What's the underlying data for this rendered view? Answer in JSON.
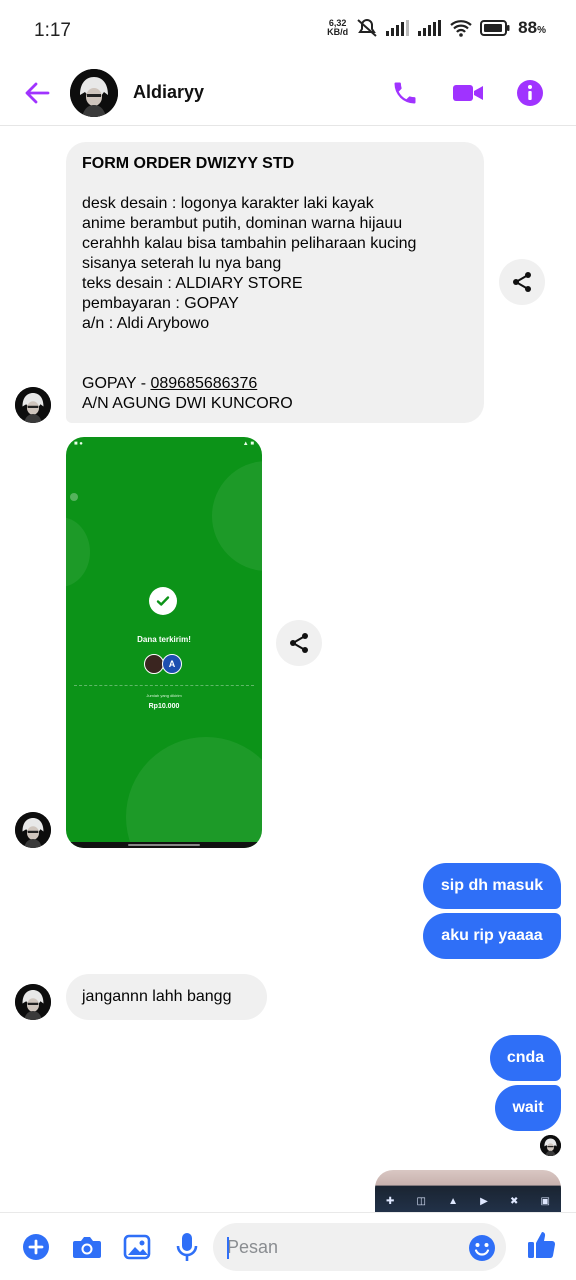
{
  "status_bar": {
    "time": "1:17",
    "net_speed_value": "6,32",
    "net_speed_unit": "KB/d",
    "battery_value": "88",
    "battery_unit": "%"
  },
  "header": {
    "contact_name": "Aldiaryy",
    "back_icon": "arrow-left-icon",
    "actions": [
      "phone-icon",
      "video-icon",
      "info-icon"
    ]
  },
  "messages": {
    "form_order": {
      "lines": [
        "FORM ORDER DWIZYY STD",
        "",
        "desk desain : logonya karakter laki kayak",
        "anime berambut putih, dominan warna hijauu",
        "cerahhh kalau bisa tambahin peliharaan kucing",
        "sisanya seterah lu nya bang",
        "teks desain : ALDIARY STORE",
        "pembayaran : GOPAY",
        "a/n : Aldi Arybowo",
        "",
        ""
      ],
      "gopay_prefix": "GOPAY - ",
      "gopay_number": "089685686376",
      "account_name": "A/N AGUNG DWI KUNCORO"
    },
    "payment_image": {
      "title": "Dana terkirim!",
      "recipient_initial": "A",
      "amount_label": "Jumlah yang dikirim",
      "amount": "Rp10.000"
    },
    "outgoing_1": "sip dh masuk",
    "outgoing_2": "aku rip yaaaa",
    "incoming_reply": "jangannn lahh bangg",
    "outgoing_3": "cnda",
    "outgoing_4": "wait"
  },
  "composer": {
    "placeholder": "Pesan",
    "icons": [
      "plus-icon",
      "camera-icon",
      "image-icon",
      "microphone-icon",
      "emoji-icon",
      "thumbs-up-icon"
    ]
  },
  "colors": {
    "accent_purple": "#a033ff",
    "bubble_blue": "#2f6ff7",
    "bubble_gray": "#f0f0f0",
    "payment_green": "#0c9318"
  }
}
